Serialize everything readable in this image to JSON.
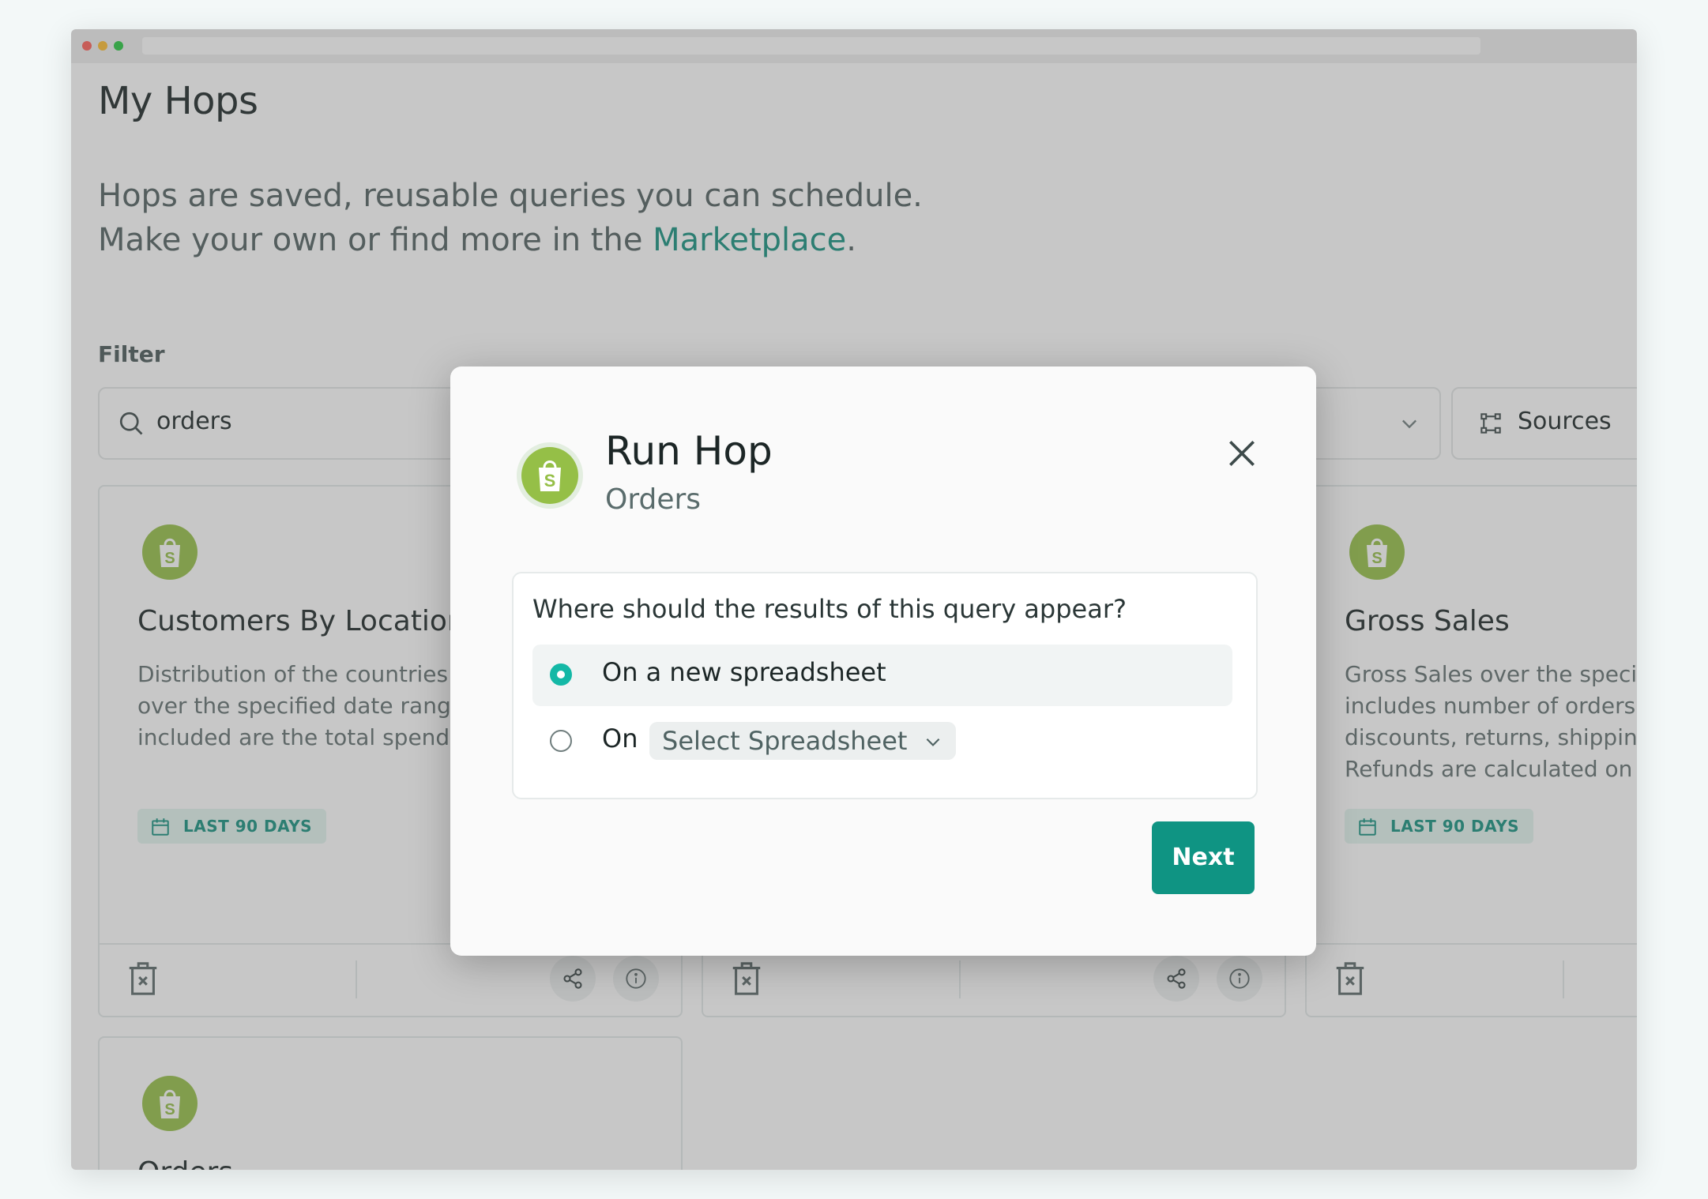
{
  "page": {
    "title": "My Hops",
    "intro_line1": "Hops are saved, reusable queries you can schedule.",
    "intro_line2_prefix": "Make your own or find more in the ",
    "intro_link": "Marketplace",
    "intro_line2_suffix": "."
  },
  "filter": {
    "label": "Filter",
    "search_value": "orders",
    "sources_label": "Sources"
  },
  "cards": [
    {
      "title": "Customers By Location",
      "description": "Distribution of the countries your customers over the specified date range are from. Also included are the total spends.",
      "badge": "LAST 90 DAYS"
    },
    {
      "title": "",
      "description": "",
      "badge": ""
    },
    {
      "title": "Gross Sales",
      "description": "Gross Sales over the specified date range. Data includes number of orders, items ordered, discounts, returns, shipping, taxes and more. Refunds are calculated on the",
      "badge": "LAST 90 DAYS"
    },
    {
      "title": "Orders",
      "description": "",
      "badge": ""
    }
  ],
  "modal": {
    "title": "Run Hop",
    "subtitle": "Orders",
    "question": "Where should the results of this query appear?",
    "option1": "On a new spreadsheet",
    "option2_prefix": "On",
    "select_placeholder": "Select Spreadsheet",
    "next_label": "Next"
  },
  "colors": {
    "accent": "#14907f",
    "radio_active": "#14b8a6",
    "shopify_green": "#95bf47"
  }
}
